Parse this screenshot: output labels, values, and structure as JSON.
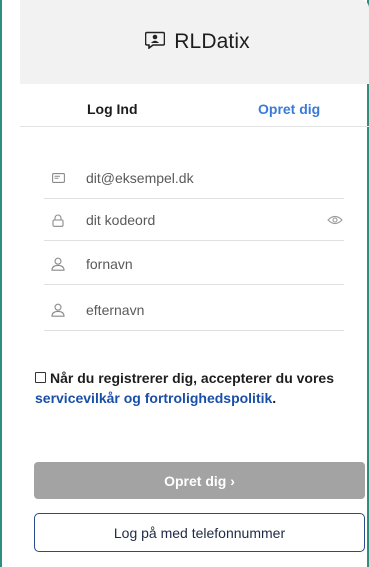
{
  "header": {
    "brand": "RLDatix",
    "logo_icon": "chat-person-icon"
  },
  "tabs": [
    {
      "label": "Log Ind",
      "active": false
    },
    {
      "label": "Opret dig",
      "active": true
    }
  ],
  "form": {
    "email": {
      "placeholder": "dit@eksempel.dk",
      "value": "",
      "icon": "mail-icon"
    },
    "password": {
      "placeholder": "dit kodeord",
      "value": "",
      "icon": "lock-icon",
      "toggle_icon": "eye-icon"
    },
    "first_name": {
      "placeholder": "fornavn",
      "value": "",
      "icon": "user-icon"
    },
    "last_name": {
      "placeholder": "efternavn",
      "value": "",
      "icon": "user-icon"
    }
  },
  "terms": {
    "text": "Når du registrerer dig, accepterer du vores",
    "link": "servicevilkår og fortrolighedspolitik",
    "suffix": ".",
    "checked": false
  },
  "buttons": {
    "signup": "Opret dig ›",
    "phone_login": "Log på med telefonnummer"
  },
  "colors": {
    "accent_link": "#3a7bd5",
    "terms_link": "#1a4fa8",
    "disabled_button": "#a3a3a3",
    "frame_border": "#2f8f7f"
  }
}
